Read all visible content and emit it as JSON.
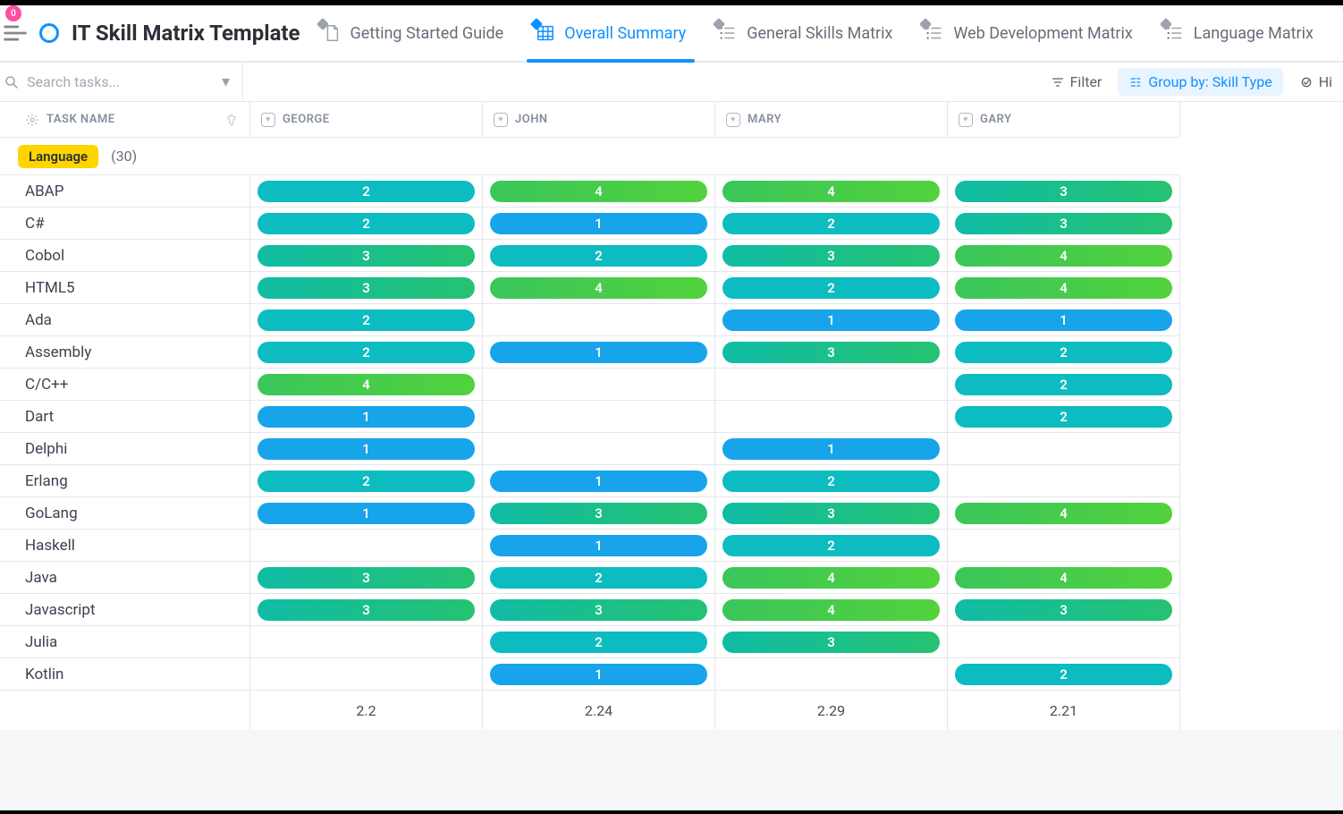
{
  "notif": "0",
  "header": {
    "title": "IT Skill Matrix Template",
    "tabs": [
      {
        "label": "Getting Started Guide",
        "icon": "doc",
        "active": false
      },
      {
        "label": "Overall Summary",
        "icon": "table",
        "active": true
      },
      {
        "label": "General Skills Matrix",
        "icon": "list",
        "active": false
      },
      {
        "label": "Web Development Matrix",
        "icon": "list",
        "active": false
      },
      {
        "label": "Language Matrix",
        "icon": "list",
        "active": false
      }
    ]
  },
  "toolbar": {
    "search_placeholder": "Search tasks...",
    "filter_label": "Filter",
    "group_label": "Group by: Skill Type",
    "hide_label": "Hi"
  },
  "columns": {
    "task_label": "TASK NAME",
    "people": [
      "GEORGE",
      "JOHN",
      "MARY",
      "GARY"
    ]
  },
  "group": {
    "name": "Language",
    "count": "(30)"
  },
  "rows": [
    {
      "name": "ABAP",
      "v": [
        2,
        4,
        4,
        3
      ]
    },
    {
      "name": "C#",
      "v": [
        2,
        1,
        2,
        3
      ]
    },
    {
      "name": "Cobol",
      "v": [
        3,
        2,
        3,
        4
      ]
    },
    {
      "name": "HTML5",
      "v": [
        3,
        4,
        2,
        4
      ]
    },
    {
      "name": "Ada",
      "v": [
        2,
        null,
        1,
        1
      ]
    },
    {
      "name": "Assembly",
      "v": [
        2,
        1,
        3,
        2
      ]
    },
    {
      "name": "C/C++",
      "v": [
        4,
        null,
        null,
        2
      ]
    },
    {
      "name": "Dart",
      "v": [
        1,
        null,
        null,
        2
      ]
    },
    {
      "name": "Delphi",
      "v": [
        1,
        null,
        1,
        null
      ]
    },
    {
      "name": "Erlang",
      "v": [
        2,
        1,
        2,
        null
      ]
    },
    {
      "name": "GoLang",
      "v": [
        1,
        3,
        3,
        4
      ]
    },
    {
      "name": "Haskell",
      "v": [
        null,
        1,
        2,
        null
      ]
    },
    {
      "name": "Java",
      "v": [
        3,
        2,
        4,
        4
      ]
    },
    {
      "name": "Javascript",
      "v": [
        3,
        3,
        4,
        3
      ]
    },
    {
      "name": "Julia",
      "v": [
        null,
        2,
        3,
        null
      ]
    },
    {
      "name": "Kotlin",
      "v": [
        null,
        1,
        null,
        2
      ]
    }
  ],
  "footer": [
    "2.2",
    "2.24",
    "2.29",
    "2.21"
  ]
}
